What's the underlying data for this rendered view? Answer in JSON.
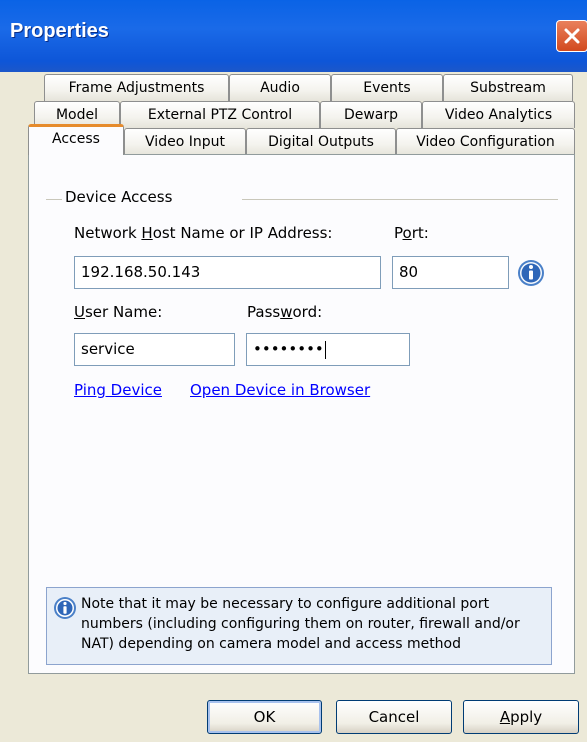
{
  "window": {
    "title": "Properties"
  },
  "tabs": {
    "row1": [
      "Frame Adjustments",
      "Audio",
      "Events",
      "Substream"
    ],
    "row2": [
      "Model",
      "External PTZ Control",
      "Dewarp",
      "Video Analytics"
    ],
    "row3": [
      "Access",
      "Video Input",
      "Digital Outputs",
      "Video Configuration"
    ],
    "active": "Access"
  },
  "device_access": {
    "group_label": "Device Access",
    "host_label_pre": "Network ",
    "host_label_u": "H",
    "host_label_post": "ost Name or IP Address:",
    "host_value": "192.168.50.143",
    "port_label_pre": "P",
    "port_label_u": "o",
    "port_label_post": "rt:",
    "port_value": "80",
    "user_label_u": "U",
    "user_label_post": "ser Name:",
    "user_value": "service",
    "password_label_pre": "Pass",
    "password_label_u": "w",
    "password_label_post": "ord:",
    "password_value": "••••••••",
    "ping_link": "Ping Device",
    "browser_link": "Open Device in Browser"
  },
  "note": {
    "text": "Note that it may be necessary to configure additional port numbers (including configuring them on router, firewall and/or NAT) depending on camera model and access method"
  },
  "buttons": {
    "ok": "OK",
    "cancel": "Cancel",
    "apply_u": "A",
    "apply_post": "pply"
  },
  "colors": {
    "titlebar": "#0A63E6",
    "active_tab_accent": "#E68B2C",
    "link": "#0000FF",
    "close": "#D24A1F"
  },
  "icons": [
    "close-icon",
    "info-icon"
  ]
}
